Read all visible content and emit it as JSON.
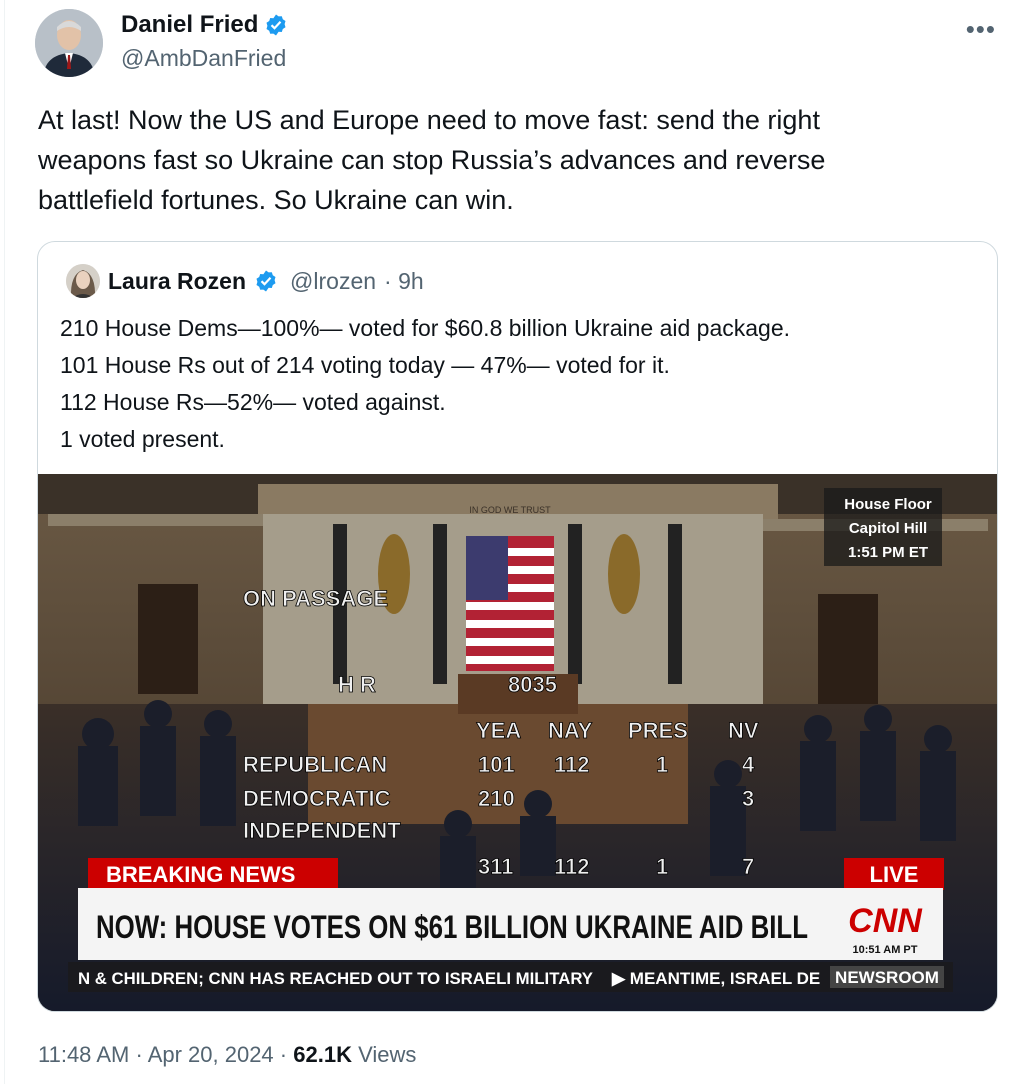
{
  "author": {
    "name": "Daniel Fried",
    "handle": "@AmbDanFried"
  },
  "tweet": {
    "lines": [
      "At last! Now the US and Europe need to move fast: send the right",
      "weapons fast so Ukraine can stop Russia’s advances and reverse",
      "battlefield fortunes. So Ukraine can win."
    ]
  },
  "quoted": {
    "name": "Laura Rozen",
    "handle": "@lrozen",
    "time": "· 9h",
    "lines": [
      "210 House Dems—100%— voted for $60.8 billion Ukraine aid package.",
      "101 House Rs out of 214 voting today — 47%— voted for it.",
      "112 House Rs—52%— voted against.",
      "1 voted present."
    ],
    "image": {
      "motto": "IN GOD WE TRUST",
      "corner": [
        "House Floor",
        "Capitol Hill",
        "1:51 PM ET"
      ],
      "on_passage": "ON PASSAGE",
      "hr_label": "H R",
      "hr_number": "8035",
      "columns": [
        "YEA",
        "NAY",
        "PRES",
        "NV"
      ],
      "rows": [
        {
          "party": "REPUBLICAN",
          "values": [
            "101",
            "112",
            "1",
            "4"
          ]
        },
        {
          "party": "DEMOCRATIC",
          "values": [
            "210",
            "",
            "",
            "3"
          ]
        },
        {
          "party": "INDEPENDENT",
          "values": [
            "",
            "",
            "",
            ""
          ]
        }
      ],
      "totals": [
        "311",
        "112",
        "1",
        "7"
      ],
      "breaking": "BREAKING NEWS",
      "live": "LIVE",
      "headline": "NOW: HOUSE VOTES ON $61 BILLION UKRAINE AID BILL",
      "network": "CNN",
      "network_time": "10:51 AM PT",
      "ticker": "N & CHILDREN; CNN HAS REACHED OUT TO ISRAELI MILITARY",
      "ticker2": "▶ MEANTIME, ISRAEL DE",
      "newsroom": "NEWSROOM"
    }
  },
  "footer": {
    "time": "11:48 AM",
    "sep": "·",
    "date": "Apr 20, 2024",
    "sep2": "·",
    "views": "62.1K",
    "views_label": "Views"
  },
  "colors": {
    "verified": "#1d9bf0",
    "cnn_red": "#cc0000"
  }
}
